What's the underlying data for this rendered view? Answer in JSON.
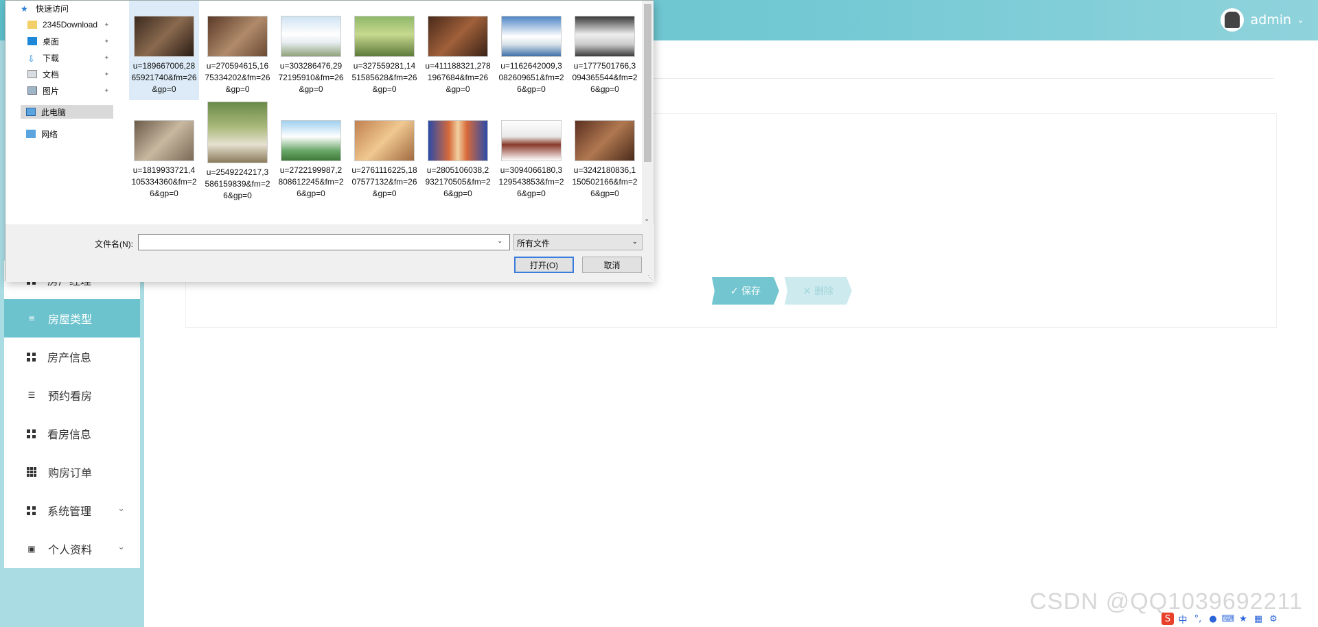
{
  "header": {
    "username": "admin"
  },
  "sidebar": {
    "items": [
      {
        "label": "房产经理",
        "icon": "grid-icon"
      },
      {
        "label": "房屋类型",
        "icon": "sliders-icon",
        "active": true
      },
      {
        "label": "房产信息",
        "icon": "grid-icon"
      },
      {
        "label": "预约看房",
        "icon": "list-icon"
      },
      {
        "label": "看房信息",
        "icon": "grid-icon"
      },
      {
        "label": "购房订单",
        "icon": "grid9-icon"
      },
      {
        "label": "系统管理",
        "icon": "grid-icon",
        "expandable": true
      },
      {
        "label": "个人资料",
        "icon": "card-icon",
        "expandable": true
      }
    ]
  },
  "form": {
    "save_label": "✓ 保存",
    "delete_label": "✕ 删除"
  },
  "dialog": {
    "nav": {
      "quick_access": "快速访问",
      "folders": [
        "2345Download",
        "桌面",
        "下载",
        "文档",
        "图片"
      ],
      "this_pc": "此电脑",
      "network": "网络"
    },
    "files": [
      "u=189667006,2865921740&fm=26&gp=0",
      "u=270594615,1675334202&fm=26&gp=0",
      "u=303286476,2972195910&fm=26&gp=0",
      "u=327559281,1451585628&fm=26&gp=0",
      "u=411188321,2781967684&fm=26&gp=0",
      "u=1162642009,3082609651&fm=26&gp=0",
      "u=1777501766,3094365544&fm=26&gp=0",
      "u=1819933721,4105334360&fm=26&gp=0",
      "u=2549224217,3586159839&fm=26&gp=0",
      "u=2722199987,2808612245&fm=26&gp=0",
      "u=2761116225,1807577132&fm=26&gp=0",
      "u=2805106038,2932170505&fm=26&gp=0",
      "u=3094066180,3129543853&fm=26&gp=0",
      "u=3242180836,1150502166&fm=26&gp=0"
    ],
    "file_name_label": "文件名(N):",
    "file_name_value": "",
    "file_type_value": "所有文件",
    "open_label": "打开(O)",
    "cancel_label": "取消"
  },
  "watermark": "CSDN @QQ1039692211",
  "colors": {
    "accent": "#6cc3cd",
    "header": "#72c8d3",
    "sidebar_bg": "#a9dce3"
  }
}
